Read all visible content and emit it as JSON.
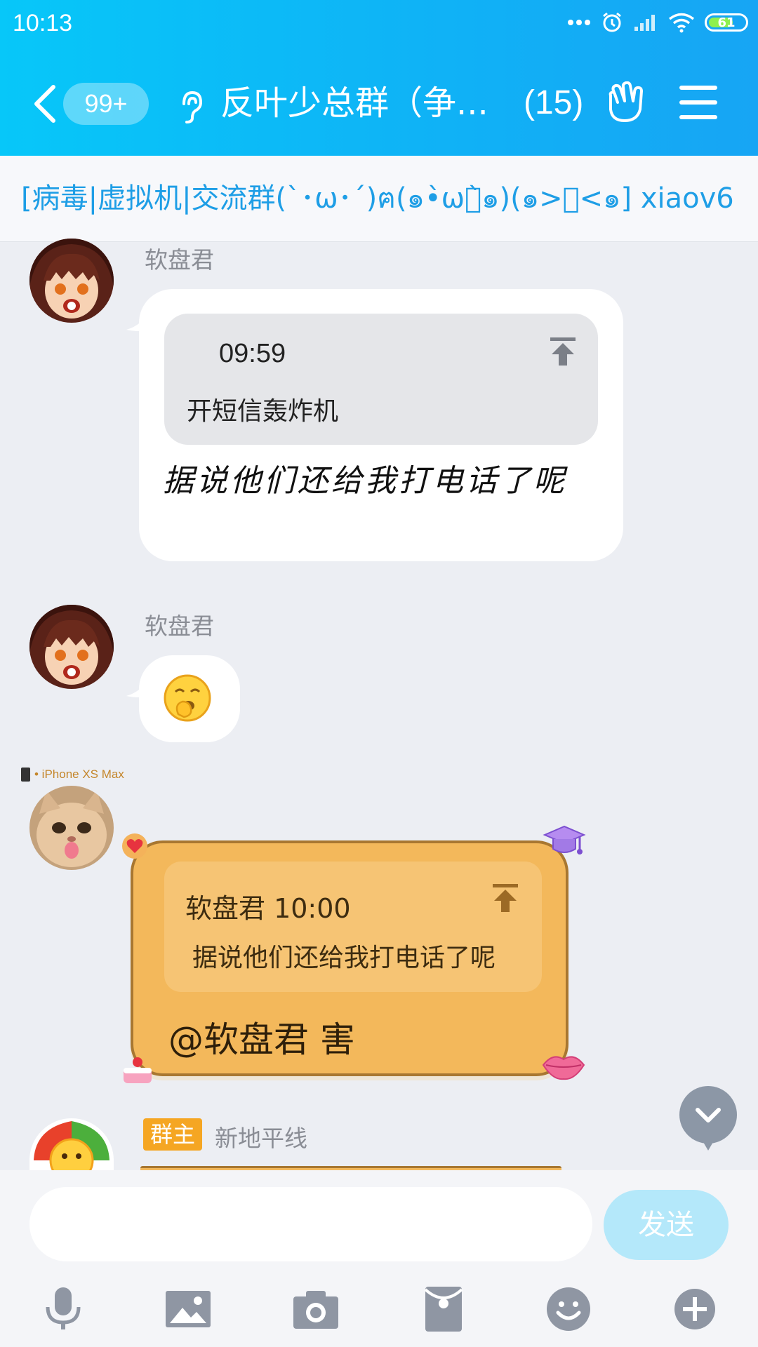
{
  "status_bar": {
    "time": "10:13",
    "battery": "61"
  },
  "header": {
    "unread_badge": "99+",
    "group_title": "反叶少总群（争...",
    "member_count": "(15)"
  },
  "announcement": {
    "text": "[病毒|虚拟机|交流群(`･ω･´)ฅ(๑•̀ωก̀๑)(๑>︶<๑] xiaov6"
  },
  "messages": [
    {
      "sender": "软盘君",
      "quote": {
        "time": "09:59",
        "text": "开短信轰炸机"
      },
      "text": "据说他们还给我打电话了呢"
    },
    {
      "sender": "软盘君",
      "emoji": "yawn-emoji"
    },
    {
      "device": "• iPhone XS Max",
      "quote": {
        "header": "软盘君 10:00",
        "text": "据说他们还给我打电话了呢"
      },
      "text": "@软盘君 害"
    },
    {
      "role_badge": "群主",
      "sender": "新地平线"
    }
  ],
  "input": {
    "placeholder": "",
    "send_label": "发送"
  },
  "toolbar": [
    "microphone-icon",
    "image-icon",
    "camera-icon",
    "red-packet-icon",
    "emoji-icon",
    "plus-icon"
  ],
  "colors": {
    "header_start": "#07c7f9",
    "header_end": "#17a5f4",
    "announcement_text": "#1e9ee6",
    "chat_background": "#eceef3",
    "fancy_bubble": "#f3b85b",
    "owner_badge": "#f5a623",
    "send_button": "#b4e8fa"
  }
}
